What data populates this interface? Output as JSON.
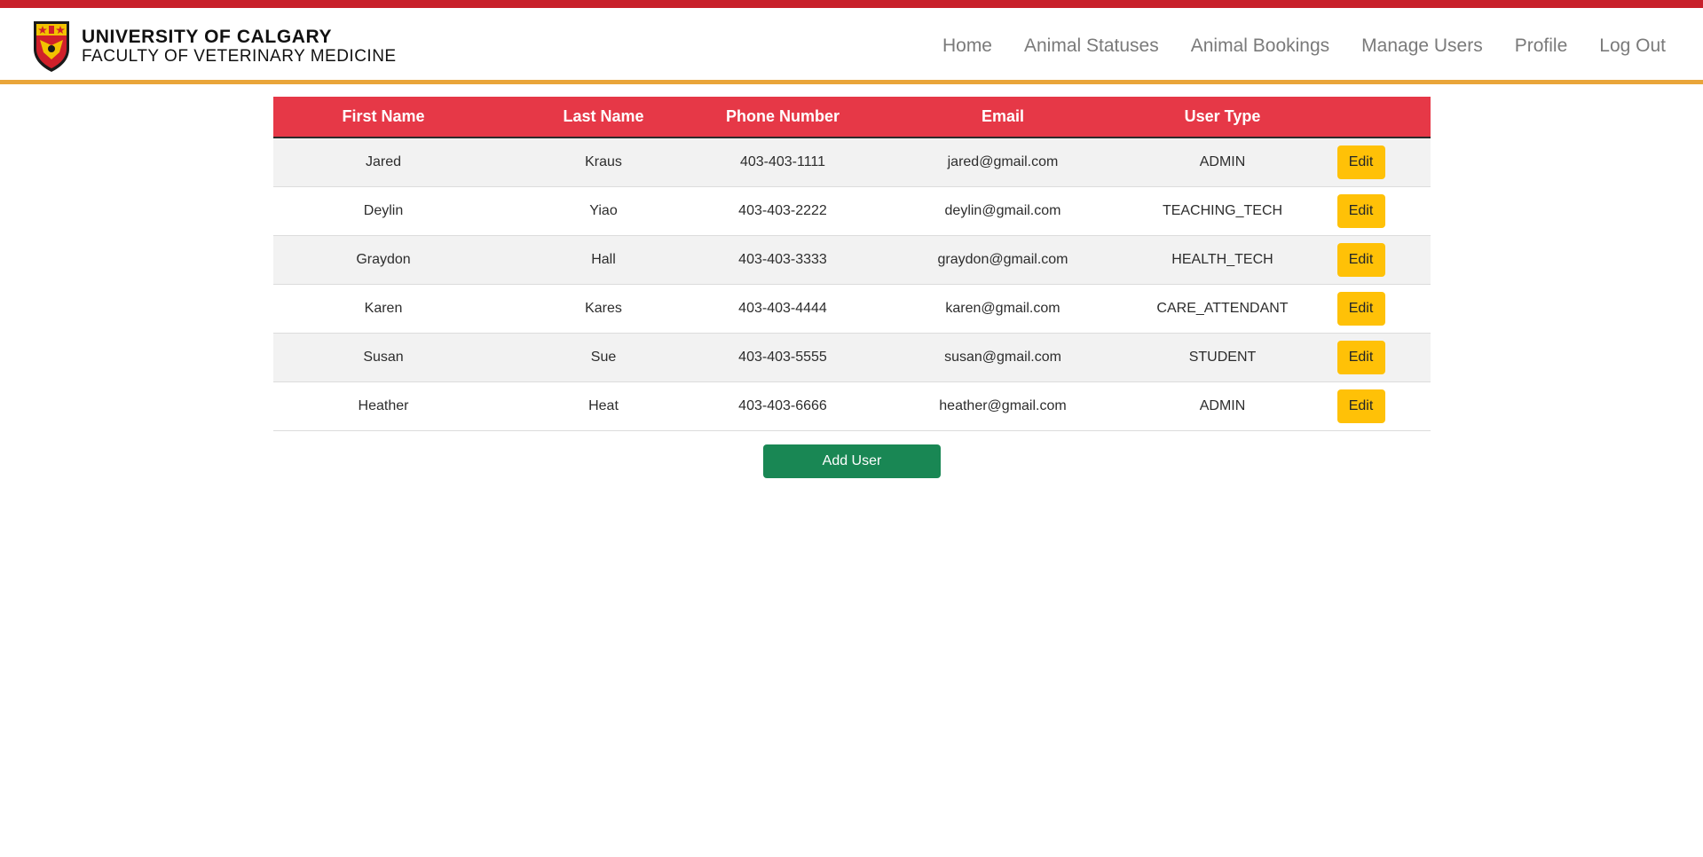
{
  "brand": {
    "line1": "UNIVERSITY OF CALGARY",
    "line2": "FACULTY OF VETERINARY MEDICINE",
    "logo_icon": "university-crest-icon"
  },
  "nav": {
    "home": "Home",
    "animal_statuses": "Animal Statuses",
    "animal_bookings": "Animal Bookings",
    "manage_users": "Manage Users",
    "profile": "Profile",
    "log_out": "Log Out"
  },
  "table": {
    "headers": [
      "First Name",
      "Last Name",
      "Phone Number",
      "Email",
      "User Type",
      ""
    ],
    "rows": [
      {
        "first": "Jared",
        "last": "Kraus",
        "phone": "403-403-1111",
        "email": "jared@gmail.com",
        "type": "ADMIN",
        "action": "Edit"
      },
      {
        "first": "Deylin",
        "last": "Yiao",
        "phone": "403-403-2222",
        "email": "deylin@gmail.com",
        "type": "TEACHING_TECH",
        "action": "Edit"
      },
      {
        "first": "Graydon",
        "last": "Hall",
        "phone": "403-403-3333",
        "email": "graydon@gmail.com",
        "type": "HEALTH_TECH",
        "action": "Edit"
      },
      {
        "first": "Karen",
        "last": "Kares",
        "phone": "403-403-4444",
        "email": "karen@gmail.com",
        "type": "CARE_ATTENDANT",
        "action": "Edit"
      },
      {
        "first": "Susan",
        "last": "Sue",
        "phone": "403-403-5555",
        "email": "susan@gmail.com",
        "type": "STUDENT",
        "action": "Edit"
      },
      {
        "first": "Heather",
        "last": "Heat",
        "phone": "403-403-6666",
        "email": "heather@gmail.com",
        "type": "ADMIN",
        "action": "Edit"
      }
    ]
  },
  "add_user_label": "Add User",
  "colors": {
    "top_stripe": "#c8202a",
    "nav_underline": "#e9a53a",
    "header_bg": "#e63847",
    "edit_button": "#ffc107",
    "add_button": "#198754"
  }
}
